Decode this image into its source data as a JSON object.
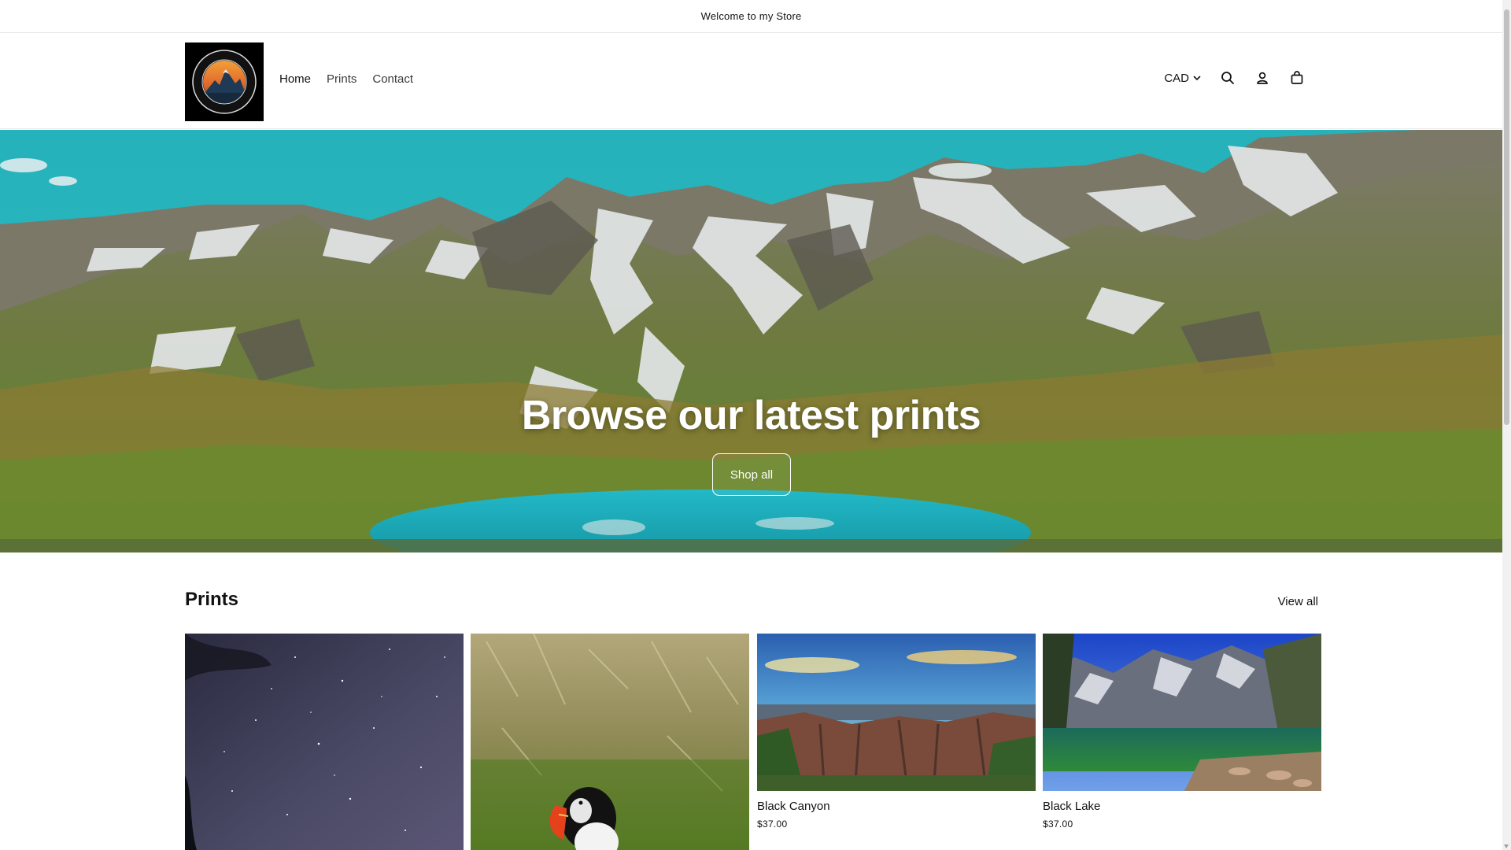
{
  "announcement": "Welcome to my Store",
  "logo": {
    "top_text": "STEPHEN'S ADVENTURE",
    "bottom_text": "PHOTOGRAPHY"
  },
  "nav": [
    {
      "label": "Home",
      "active": true
    },
    {
      "label": "Prints",
      "active": false
    },
    {
      "label": "Contact",
      "active": false
    }
  ],
  "header_tools": {
    "currency": "CAD",
    "icons": [
      "search-icon",
      "account-icon",
      "cart-icon"
    ]
  },
  "hero": {
    "title": "Browse our latest prints",
    "button": "Shop all"
  },
  "collection": {
    "title": "Prints",
    "view_all": "View all",
    "products": [
      {
        "name": "",
        "price": "",
        "image": "night-sky-milky-way"
      },
      {
        "name": "",
        "price": "",
        "image": "puffin"
      },
      {
        "name": "Black Canyon",
        "price": "$37.00",
        "image": "black-canyon"
      },
      {
        "name": "Black Lake",
        "price": "$37.00",
        "image": "black-lake"
      }
    ]
  },
  "colors": {
    "text": "#121212",
    "sky": "#1fa9b4",
    "lake": "#1fb3c2",
    "background": "#ffffff"
  }
}
